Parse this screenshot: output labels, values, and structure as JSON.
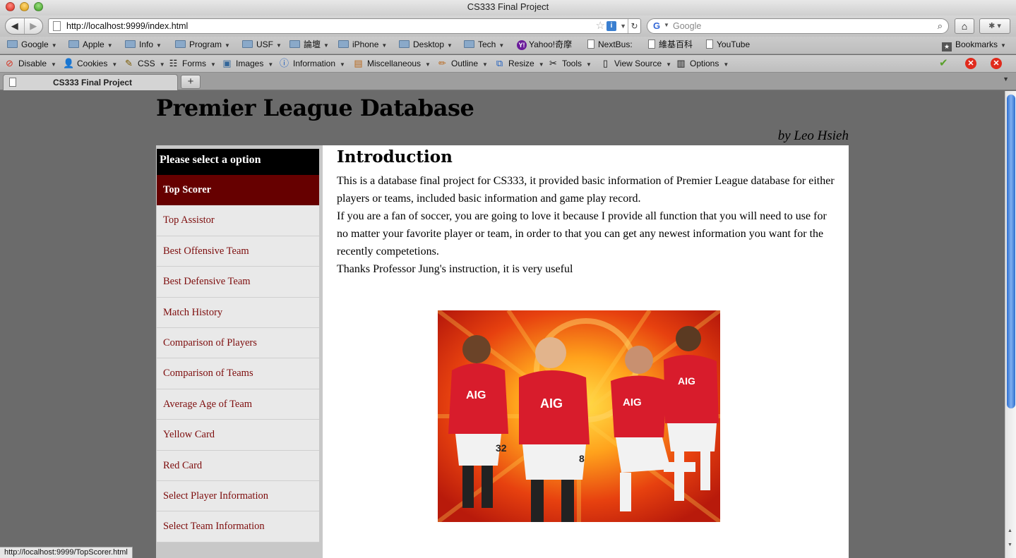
{
  "window": {
    "title": "CS333 Final Project"
  },
  "navbar": {
    "url": "http://localhost:9999/index.html",
    "search_placeholder": "Google"
  },
  "bookmarks": {
    "items": [
      {
        "label": "Google",
        "icon": "folder-icon",
        "dropdown": true
      },
      {
        "label": "Apple",
        "icon": "folder-icon",
        "dropdown": true
      },
      {
        "label": "Info",
        "icon": "folder-icon",
        "dropdown": true
      },
      {
        "label": "Program",
        "icon": "folder-icon",
        "dropdown": true
      },
      {
        "label": "USF",
        "icon": "folder-icon",
        "dropdown": true
      },
      {
        "label": "論壇",
        "icon": "folder-icon",
        "dropdown": true
      },
      {
        "label": "iPhone",
        "icon": "folder-icon",
        "dropdown": true
      },
      {
        "label": "Desktop",
        "icon": "folder-icon",
        "dropdown": true
      },
      {
        "label": "Tech",
        "icon": "folder-icon",
        "dropdown": true
      },
      {
        "label": "Yahoo!奇摩",
        "icon": "yahoo-icon",
        "dropdown": false
      },
      {
        "label": "NextBus:",
        "icon": "page-icon",
        "dropdown": false
      },
      {
        "label": "維基百科",
        "icon": "page-icon",
        "dropdown": false
      },
      {
        "label": "YouTube",
        "icon": "page-icon",
        "dropdown": false
      }
    ],
    "bookmarks_label": "Bookmarks"
  },
  "devtoolbar": {
    "items": [
      {
        "label": "Disable",
        "icon": "disable-icon"
      },
      {
        "label": "Cookies",
        "icon": "cookies-icon"
      },
      {
        "label": "CSS",
        "icon": "css-icon"
      },
      {
        "label": "Forms",
        "icon": "forms-icon"
      },
      {
        "label": "Images",
        "icon": "images-icon"
      },
      {
        "label": "Information",
        "icon": "information-icon"
      },
      {
        "label": "Miscellaneous",
        "icon": "miscellaneous-icon"
      },
      {
        "label": "Outline",
        "icon": "outline-icon"
      },
      {
        "label": "Resize",
        "icon": "resize-icon"
      },
      {
        "label": "Tools",
        "icon": "tools-icon"
      },
      {
        "label": "View Source",
        "icon": "view-source-icon"
      },
      {
        "label": "Options",
        "icon": "options-icon"
      }
    ]
  },
  "tabs": [
    {
      "label": "CS333 Final Project"
    }
  ],
  "page": {
    "site_title": "Premier League Database",
    "author": "by Leo Hsieh",
    "menu_header": "Please select a option",
    "menu_items": [
      {
        "label": "Top Scorer",
        "active": true
      },
      {
        "label": "Top Assistor"
      },
      {
        "label": "Best Offensive Team"
      },
      {
        "label": "Best Defensive Team"
      },
      {
        "label": "Match History"
      },
      {
        "label": "Comparison of Players"
      },
      {
        "label": "Comparison of Teams"
      },
      {
        "label": "Average Age of Team"
      },
      {
        "label": "Yellow Card"
      },
      {
        "label": "Red Card"
      },
      {
        "label": "Select Player Information"
      },
      {
        "label": "Select Team Information"
      }
    ],
    "heading": "Introduction",
    "paragraphs": [
      "This is a database final project for CS333, it provided basic information of Premier League database for either players or teams, included basic information and game play record.",
      "If you are a fan of soccer, you are going to love it because I provide all function that you will need to use for no matter your favorite player or team, in order to that you can get any newest information you want for the recently competetions.",
      "Thanks Professor Jung's instruction, it is very useful"
    ],
    "image_shirt_text": "AIG",
    "image_shirt_numbers": [
      "32",
      "8"
    ]
  },
  "statusbar": {
    "text": "http://localhost:9999/TopScorer.html"
  },
  "colors": {
    "menu_active": "#660000",
    "menu_link": "#7d0c0c",
    "page_bg": "#6b6b6b"
  }
}
